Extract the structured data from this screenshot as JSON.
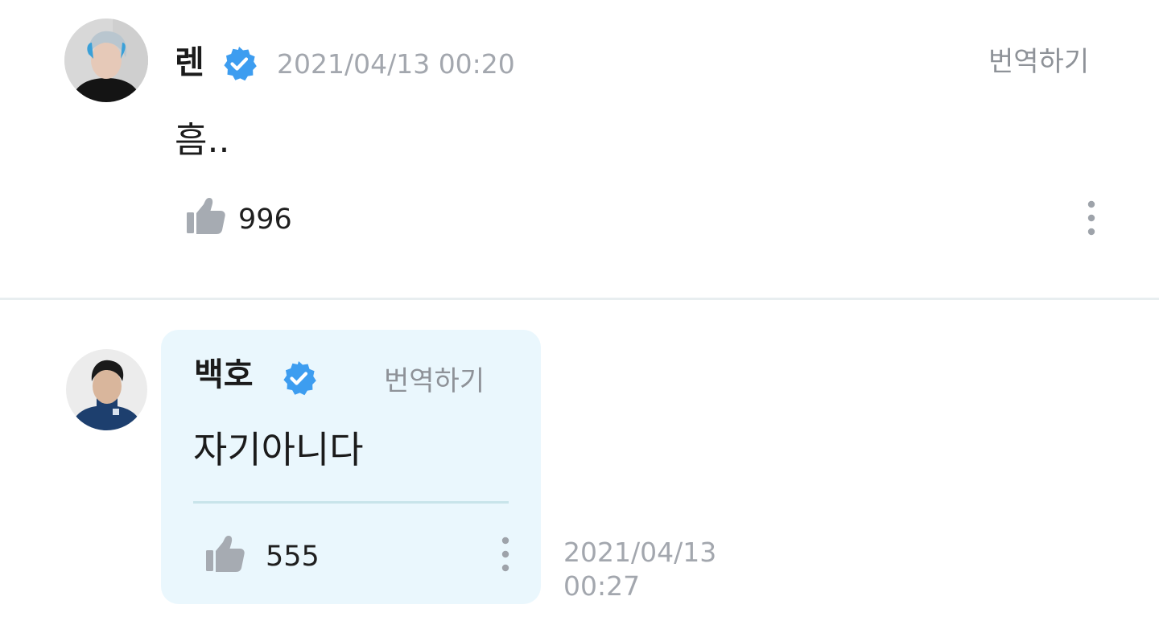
{
  "comment": {
    "author": "렌",
    "verified": true,
    "timestamp": "2021/04/13 00:20",
    "translate_label": "번역하기",
    "text": "흠..",
    "likes": "996",
    "icons": {
      "like": "thumbs-up-icon",
      "more": "more-vertical-icon",
      "verified": "verified-badge-icon"
    }
  },
  "reply": {
    "author": "백호",
    "verified": true,
    "translate_label": "번역하기",
    "text": "자기아니다",
    "likes": "555",
    "timestamp_date": "2021/04/13",
    "timestamp_time": "00:27",
    "icons": {
      "like": "thumbs-up-icon",
      "more": "more-vertical-icon",
      "verified": "verified-badge-icon"
    }
  },
  "colors": {
    "verified_badge": "#3d9df0",
    "like_icon": "#a6abb2",
    "meta_text": "#a3a7ae",
    "reply_bubble": "#eaf7fd",
    "divider": "#e8eef0"
  }
}
